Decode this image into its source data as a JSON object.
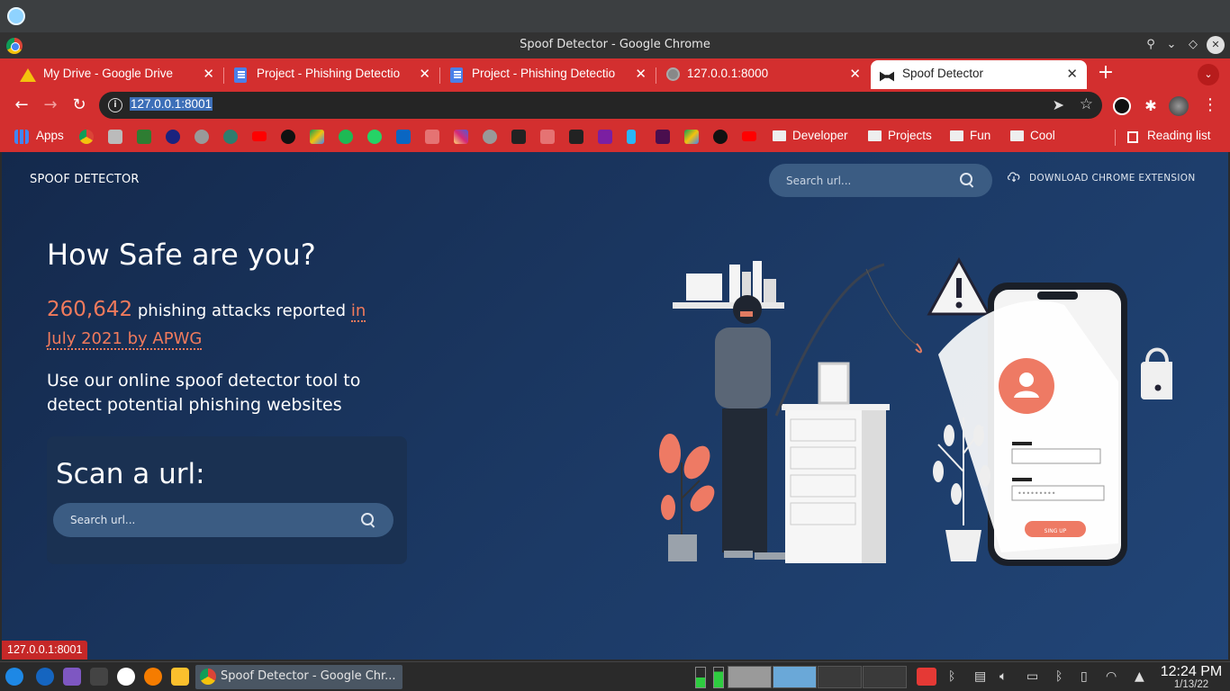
{
  "window": {
    "title": "Spoof Detector - Google Chrome"
  },
  "tabs": [
    {
      "label": "My Drive - Google Drive",
      "icon": "google-drive-icon",
      "active": false
    },
    {
      "label": "Project - Phishing Detectio",
      "icon": "google-docs-icon",
      "active": false
    },
    {
      "label": "Project - Phishing Detectio",
      "icon": "google-docs-icon",
      "active": false
    },
    {
      "label": "127.0.0.1:8000",
      "icon": "globe-icon",
      "active": false
    },
    {
      "label": "Spoof Detector",
      "icon": "bow-tie-icon",
      "active": true
    }
  ],
  "toolbar": {
    "url": "127.0.0.1:8001"
  },
  "bookmarks": {
    "apps_label": "Apps",
    "folders": [
      "Developer",
      "Projects",
      "Fun",
      "Cool"
    ],
    "reading_list": "Reading list"
  },
  "page": {
    "brand": "SPOOF DETECTOR",
    "top_search_placeholder": "Search url...",
    "download_extension": "DOWNLOAD CHROME EXTENSION",
    "hero_title": "How Safe are you?",
    "stat_number": "260,642",
    "stat_text": "phishing attacks reported",
    "stat_link_1": "in",
    "stat_link_2": "July 2021 by APWG",
    "tagline": "Use our online spoof detector tool to detect potential phishing websites",
    "scan_title": "Scan a url:",
    "scan_placeholder": "Search url...",
    "illustration_button": "SING UP"
  },
  "status_bar": {
    "hover_url": "127.0.0.1:8001"
  },
  "taskbar": {
    "active_task": "Spoof Detector - Google Chr...",
    "time": "12:24 PM",
    "date": "1/13/22"
  },
  "colors": {
    "accent_red": "#d32f2f",
    "page_bg": "#1c3a66",
    "highlight_orange": "#f07a5c"
  }
}
